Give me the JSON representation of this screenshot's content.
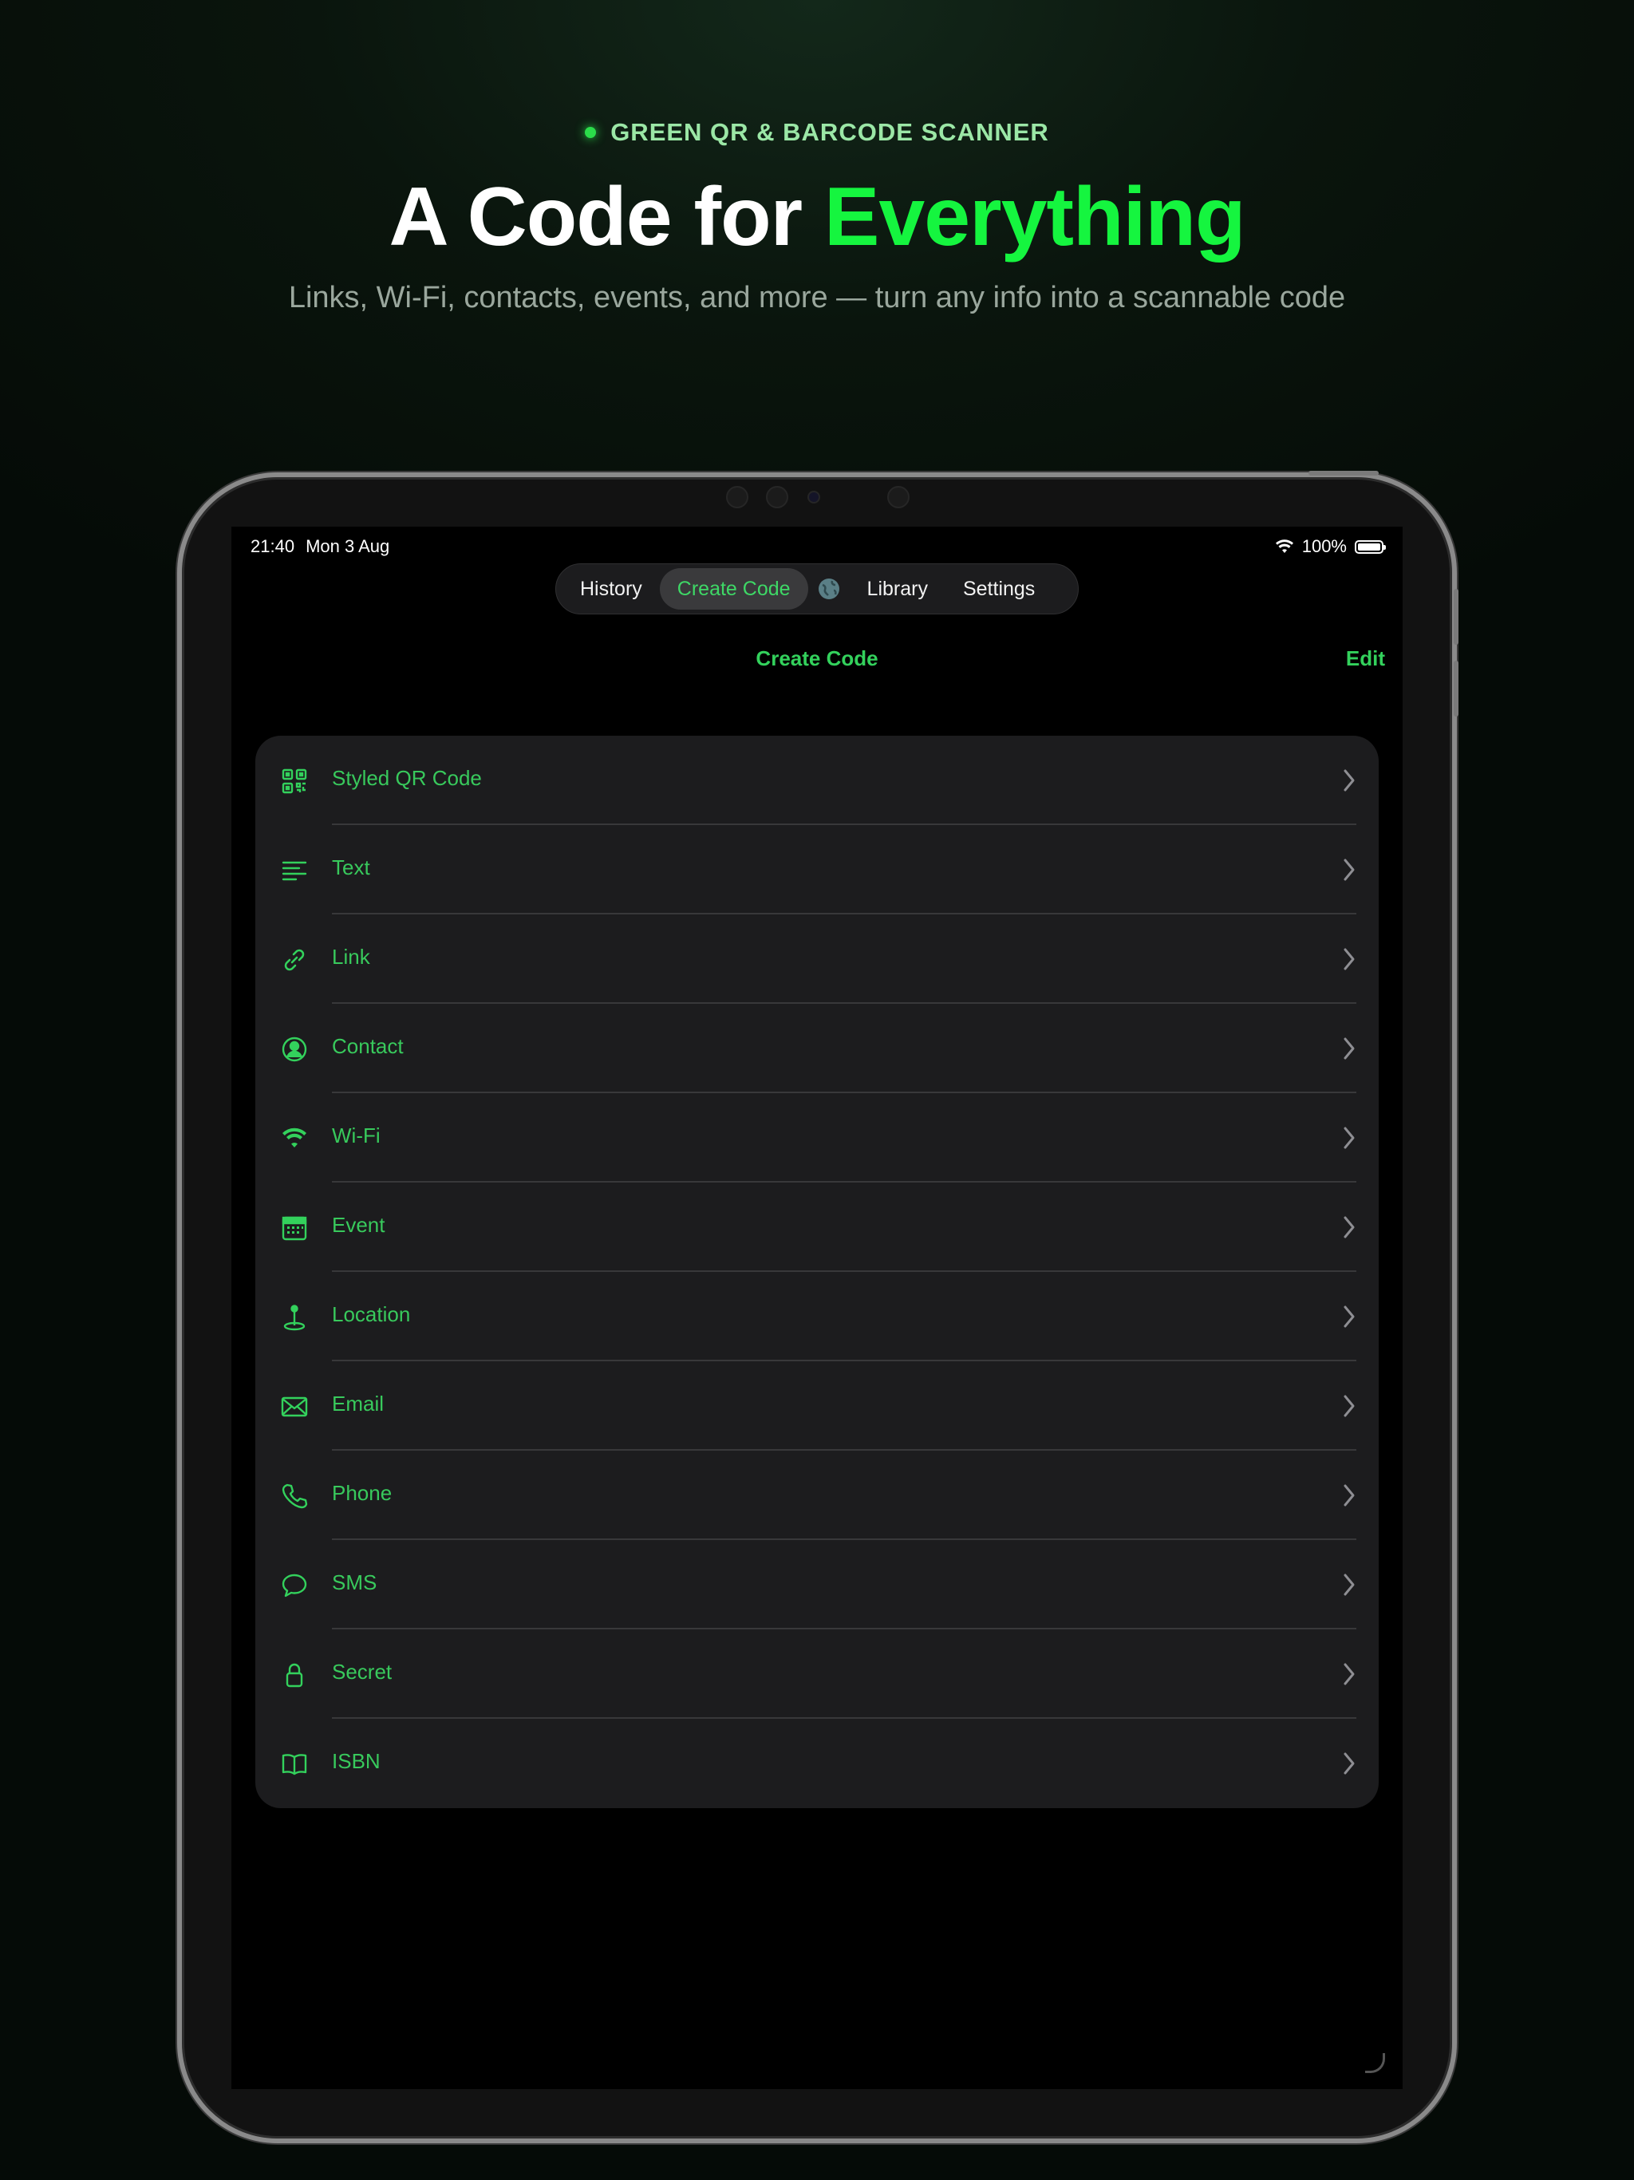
{
  "hero": {
    "eyebrow": "GREEN QR & BARCODE SCANNER",
    "headline_part1": "A Code for ",
    "headline_accent": "Everything",
    "subhead": "Links, Wi-Fi, contacts, events, and more — turn any info into a scannable code"
  },
  "colors": {
    "accent": "#33d15c",
    "headline_accent": "#15f53f",
    "card_bg": "#1c1c1e"
  },
  "status": {
    "time": "21:40",
    "date": "Mon 3 Aug",
    "battery": "100%"
  },
  "tabs": [
    {
      "label": "History"
    },
    {
      "label": "Create Code",
      "active": true
    },
    {
      "label": "Library"
    },
    {
      "label": "Settings"
    }
  ],
  "nav": {
    "title": "Create Code",
    "edit": "Edit"
  },
  "items": [
    {
      "label": "Styled QR Code",
      "icon": "qr-code-icon"
    },
    {
      "label": "Text",
      "icon": "text-lines-icon"
    },
    {
      "label": "Link",
      "icon": "link-icon"
    },
    {
      "label": "Contact",
      "icon": "person-circle-icon"
    },
    {
      "label": "Wi-Fi",
      "icon": "wifi-icon"
    },
    {
      "label": "Event",
      "icon": "calendar-icon"
    },
    {
      "label": "Location",
      "icon": "map-pin-icon"
    },
    {
      "label": "Email",
      "icon": "envelope-icon"
    },
    {
      "label": "Phone",
      "icon": "phone-icon"
    },
    {
      "label": "SMS",
      "icon": "message-bubble-icon"
    },
    {
      "label": "Secret",
      "icon": "lock-icon"
    },
    {
      "label": "ISBN",
      "icon": "book-icon"
    }
  ]
}
